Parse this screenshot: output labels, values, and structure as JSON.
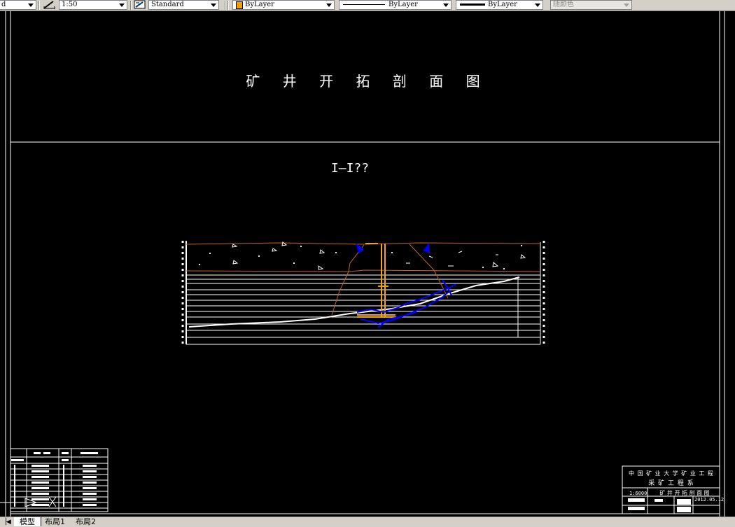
{
  "toolbar": {
    "left_partial_value": "d",
    "scale_value": "1:50",
    "dim_style_value": "Standard",
    "layer_color_value": "ByLayer",
    "linetype_value": "ByLayer",
    "lineweight_value": "ByLayer",
    "plot_style_value": "随颜色",
    "icons": [
      "dimension-scale-icon",
      "dimension-style-icon"
    ]
  },
  "drawing": {
    "main_title": "矿 井 开 拓 剖 面 图",
    "section_label": "I—I??",
    "colors": {
      "background": "#000000",
      "frame": "#ffffff",
      "rock_boundary": "#c0652a",
      "shaft": "#f0a800",
      "roadway": "#0000ff",
      "strata": "#ffffff"
    }
  },
  "title_block": {
    "school_line": "中 国 矿 业 大 学 矿 业 工 程",
    "department_line": "采 矿 工 程 系",
    "drawing_name": "矿 井 开 拓 剖 面 图",
    "scale_label": "1:6000",
    "date": "2012.05.12"
  },
  "tabs": {
    "model": "模型",
    "layout1": "布局1",
    "layout2": "布局2"
  }
}
